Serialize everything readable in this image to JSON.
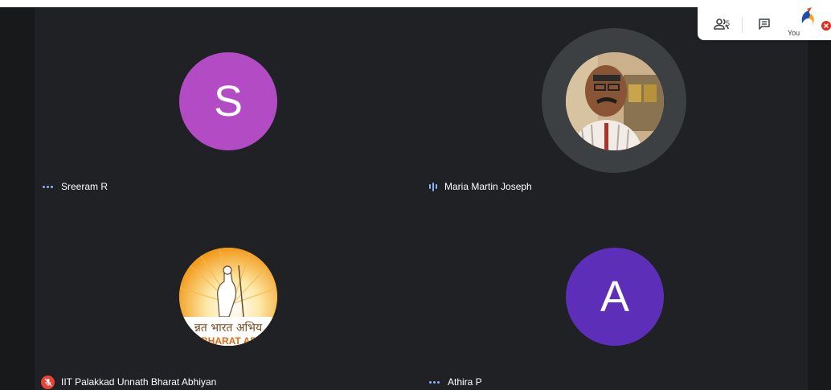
{
  "participants": [
    {
      "name": "Sreeram R",
      "initial": "S",
      "avatar_color": "#b24bc4",
      "indicator": "more-dots"
    },
    {
      "name": "Maria Martin Joseph",
      "indicator": "speaking-bars"
    },
    {
      "name": "IIT Palakkad Unnath Bharat Abhiyan",
      "indicator": "mic-off"
    },
    {
      "name": "Athira P",
      "initial": "A",
      "avatar_color": "#5d2fb8",
      "indicator": "more-dots"
    }
  ],
  "logo": {
    "line1": "न्नत भारत अभिय",
    "line2": "T BHARAT ABH"
  },
  "overlay": {
    "people_count": "5",
    "you_label": "You"
  },
  "colors": {
    "background": "#202124",
    "indicator": "#8ab4f8",
    "mic_off": "#ea4335",
    "speaking_ring": "#3c4043"
  }
}
